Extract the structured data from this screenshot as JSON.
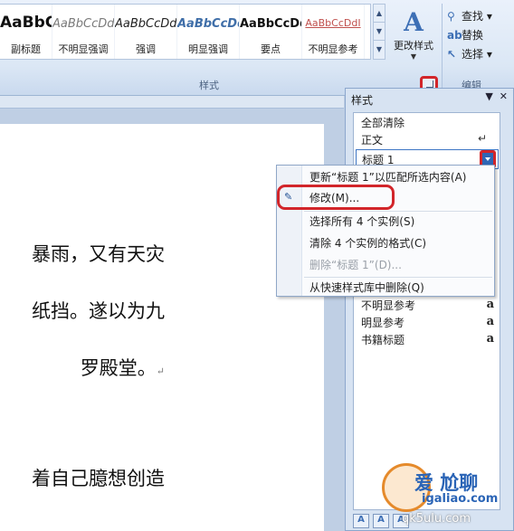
{
  "ribbon": {
    "styles_gallery": [
      {
        "sample": "AaBbC",
        "name": "副标题"
      },
      {
        "sample": "AaBbCcDd",
        "name": "不明显强调"
      },
      {
        "sample": "AaBbCcDd",
        "name": "强调"
      },
      {
        "sample": "AaBbCcDd",
        "name": "明显强调"
      },
      {
        "sample": "AaBbCcDd",
        "name": "要点"
      },
      {
        "sample": "AaBbCcDdI",
        "name": "不明显参考"
      }
    ],
    "change_styles_label": "更改样式",
    "styles_group_label": "样式",
    "editing": {
      "find": "查找",
      "replace": "替换",
      "select": "选择",
      "group_label": "编辑"
    }
  },
  "document": {
    "lines": [
      "暴雨，又有天灾",
      "纸挡。遂以为九",
      "罗殿堂。",
      "着自己臆想创造"
    ]
  },
  "styles_pane": {
    "title": "样式",
    "items_top": [
      "全部清除",
      "正文"
    ],
    "selected": "标题 1",
    "items_bottom": [
      "不明显参考",
      "明显参考",
      "书籍标题"
    ],
    "badge": "a"
  },
  "context_menu": {
    "update": "更新“标题 1”以匹配所选内容(A)",
    "modify": "修改(M)...",
    "select_all": "选择所有 4 个实例(S)",
    "clear_formatting": "清除 4 个实例的格式(C)",
    "delete": "删除“标题 1”(D)...",
    "remove_from_gallery": "从快速样式库中删除(Q)"
  },
  "watermark": {
    "line1": "爱 尬聊",
    "line2": "igaliao.com",
    "line3": "qk5ulu.com"
  }
}
